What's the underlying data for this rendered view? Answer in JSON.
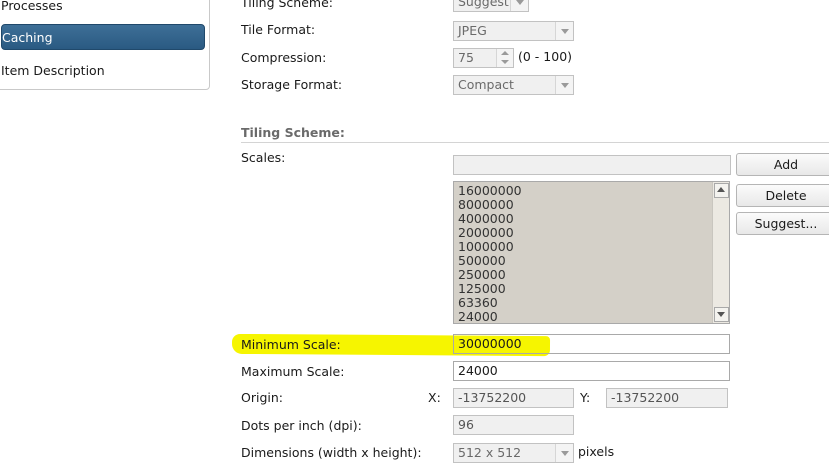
{
  "sidebar": {
    "items": [
      {
        "label": "Processes"
      },
      {
        "label": "Caching"
      },
      {
        "label": "Item Description"
      }
    ]
  },
  "form": {
    "tiling_scheme": {
      "label": "Tiling Scheme:",
      "value": "Suggest"
    },
    "tile_format": {
      "label": "Tile Format:",
      "value": "JPEG"
    },
    "compression": {
      "label": "Compression:",
      "value": "75",
      "hint": "(0 - 100)"
    },
    "storage_format": {
      "label": "Storage Format:",
      "value": "Compact"
    },
    "section_title": "Tiling Scheme:",
    "scales": {
      "label": "Scales:",
      "new_value": "",
      "list": [
        "16000000",
        "8000000",
        "4000000",
        "2000000",
        "1000000",
        "500000",
        "250000",
        "125000",
        "63360",
        "24000"
      ]
    },
    "buttons": {
      "add": "Add",
      "delete": "Delete",
      "suggest": "Suggest..."
    },
    "minimum_scale": {
      "label": "Minimum Scale:",
      "value": "30000000"
    },
    "maximum_scale": {
      "label": "Maximum Scale:",
      "value": "24000"
    },
    "origin": {
      "label": "Origin:",
      "x_label": "X:",
      "x": "-13752200",
      "y_label": "Y:",
      "y": "-13752200"
    },
    "dpi": {
      "label": "Dots per inch (dpi):",
      "value": "96"
    },
    "dimensions": {
      "label": "Dimensions (width x height):",
      "value": "512 x 512",
      "unit": "pixels"
    }
  },
  "colors": {
    "active_tab": "#2f5f87",
    "highlight": "#f6f500",
    "listbox_bg": "#d4d0c8"
  }
}
